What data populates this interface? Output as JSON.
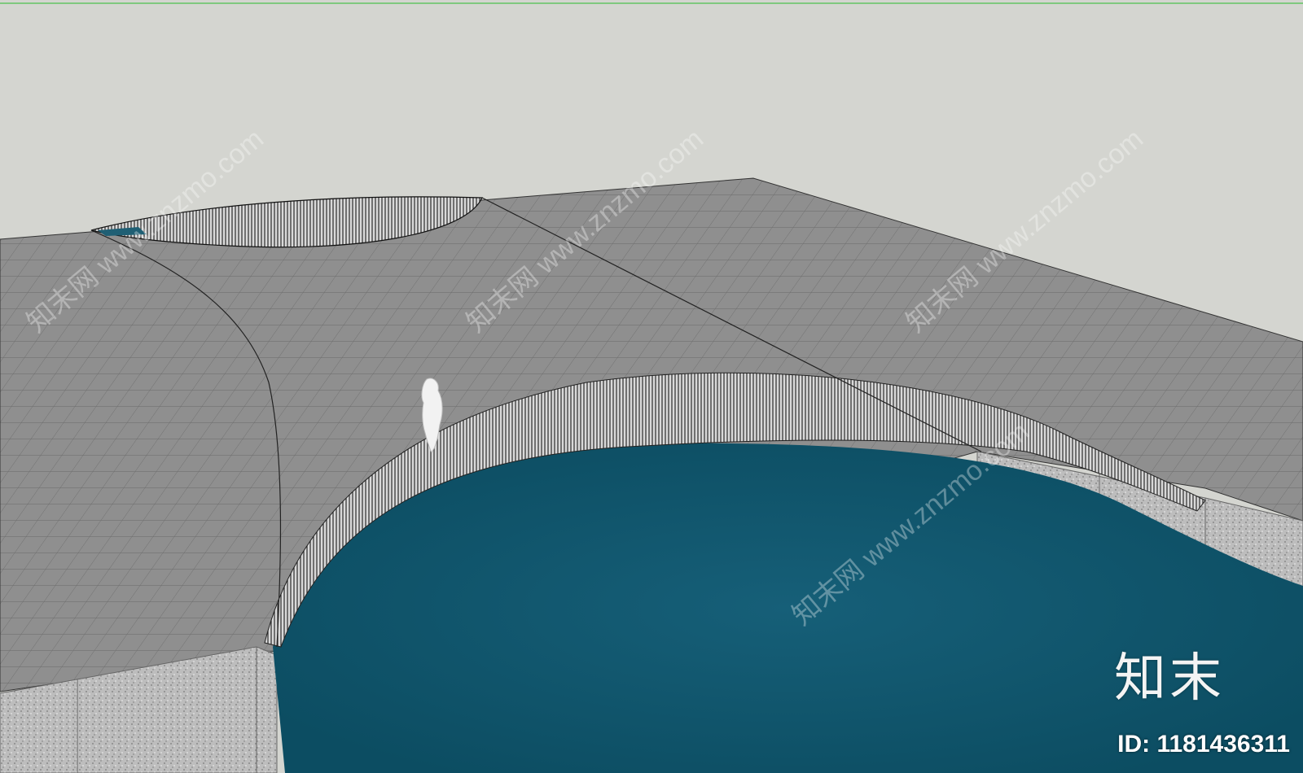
{
  "scene": {
    "colors": {
      "sky": "#d4d5d0",
      "paving": "#8f8f8f",
      "paving_grid": "#6a6a6a",
      "water": "#0f5c72",
      "stone": "#b9b9b9",
      "top_line": "#7fc97f"
    }
  },
  "watermark": {
    "site": "www.znzmo.com",
    "cn": "知末网"
  },
  "brand": {
    "logo_text": "知末",
    "id_text": "ID: 1181436311"
  }
}
